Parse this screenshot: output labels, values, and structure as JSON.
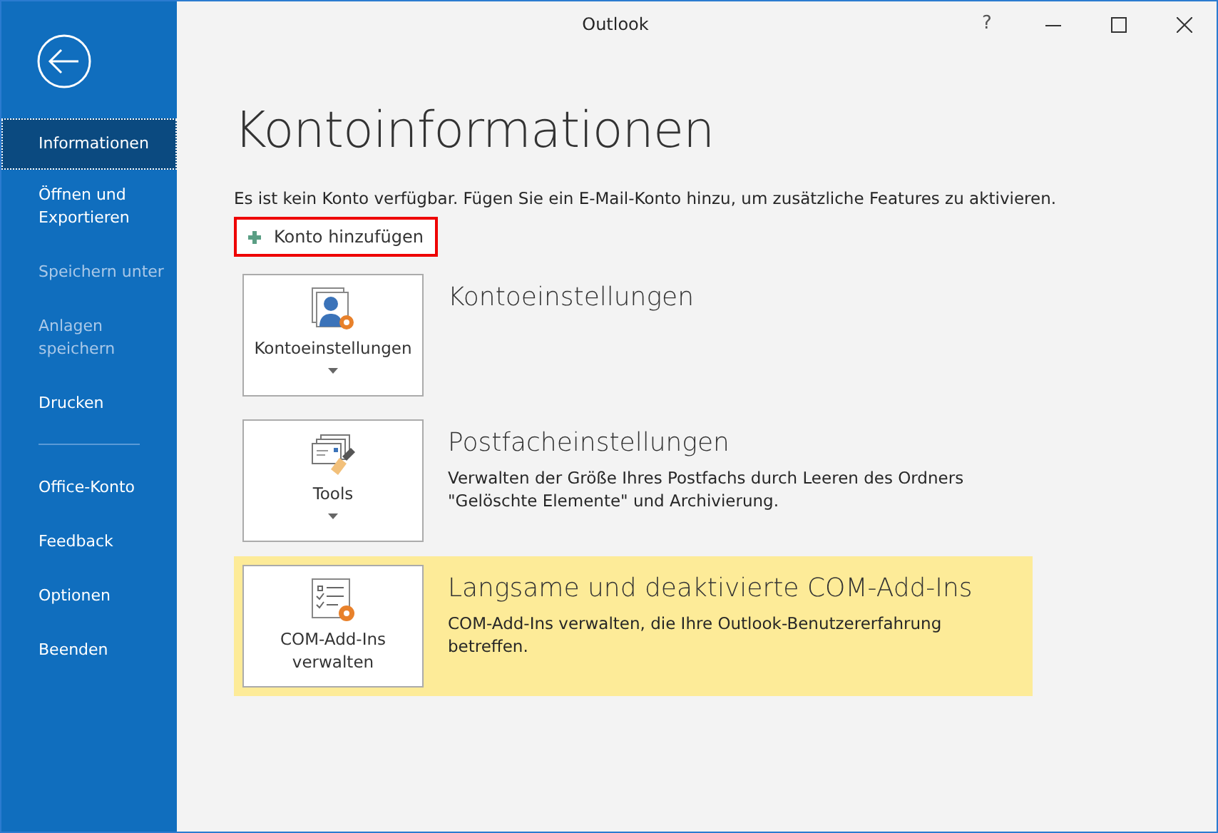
{
  "window": {
    "title": "Outlook",
    "controls": [
      "?"
    ]
  },
  "sidebar": {
    "groups": [
      [
        {
          "label": "Informationen",
          "selected": true,
          "disabled": false
        },
        {
          "label": "Öffnen und Exportieren",
          "selected": false,
          "disabled": false
        },
        {
          "label": "Speichern unter",
          "selected": false,
          "disabled": true
        },
        {
          "label": "Anlagen speichern",
          "selected": false,
          "disabled": true
        },
        {
          "label": "Drucken",
          "selected": false,
          "disabled": false
        }
      ],
      [
        {
          "label": "Office-Konto",
          "selected": false,
          "disabled": false
        },
        {
          "label": "Feedback",
          "selected": false,
          "disabled": false
        },
        {
          "label": "Optionen",
          "selected": false,
          "disabled": false
        },
        {
          "label": "Beenden",
          "selected": false,
          "disabled": false
        }
      ]
    ]
  },
  "page": {
    "title": "Kontoinformationen",
    "notice": "Es ist kein Konto verfügbar. Fügen Sie ein E-Mail-Konto hinzu, um zusätzliche Features zu aktivieren.",
    "add_account": "Konto hinzufügen"
  },
  "sections": [
    {
      "kind": "account",
      "button": "Kontoeinstellungen",
      "dropdown": true,
      "highlighted": false,
      "heading": "Kontoeinstellungen"
    },
    {
      "kind": "tools",
      "button": "Tools",
      "dropdown": true,
      "highlighted": false,
      "heading": "Postfacheinstellungen",
      "description": "Verwalten der Größe Ihres Postfachs durch Leeren des Ordners \"Gelöschte Elemente\" und Archivierung."
    },
    {
      "kind": "addins",
      "button": "COM-Add-Ins verwalten",
      "dropdown": false,
      "highlighted": true,
      "heading": "Langsame und deaktivierte COM-Add-Ins",
      "description": "COM-Add-Ins verwalten, die Ihre Outlook-Benutzererfahrung betreffen."
    }
  ]
}
